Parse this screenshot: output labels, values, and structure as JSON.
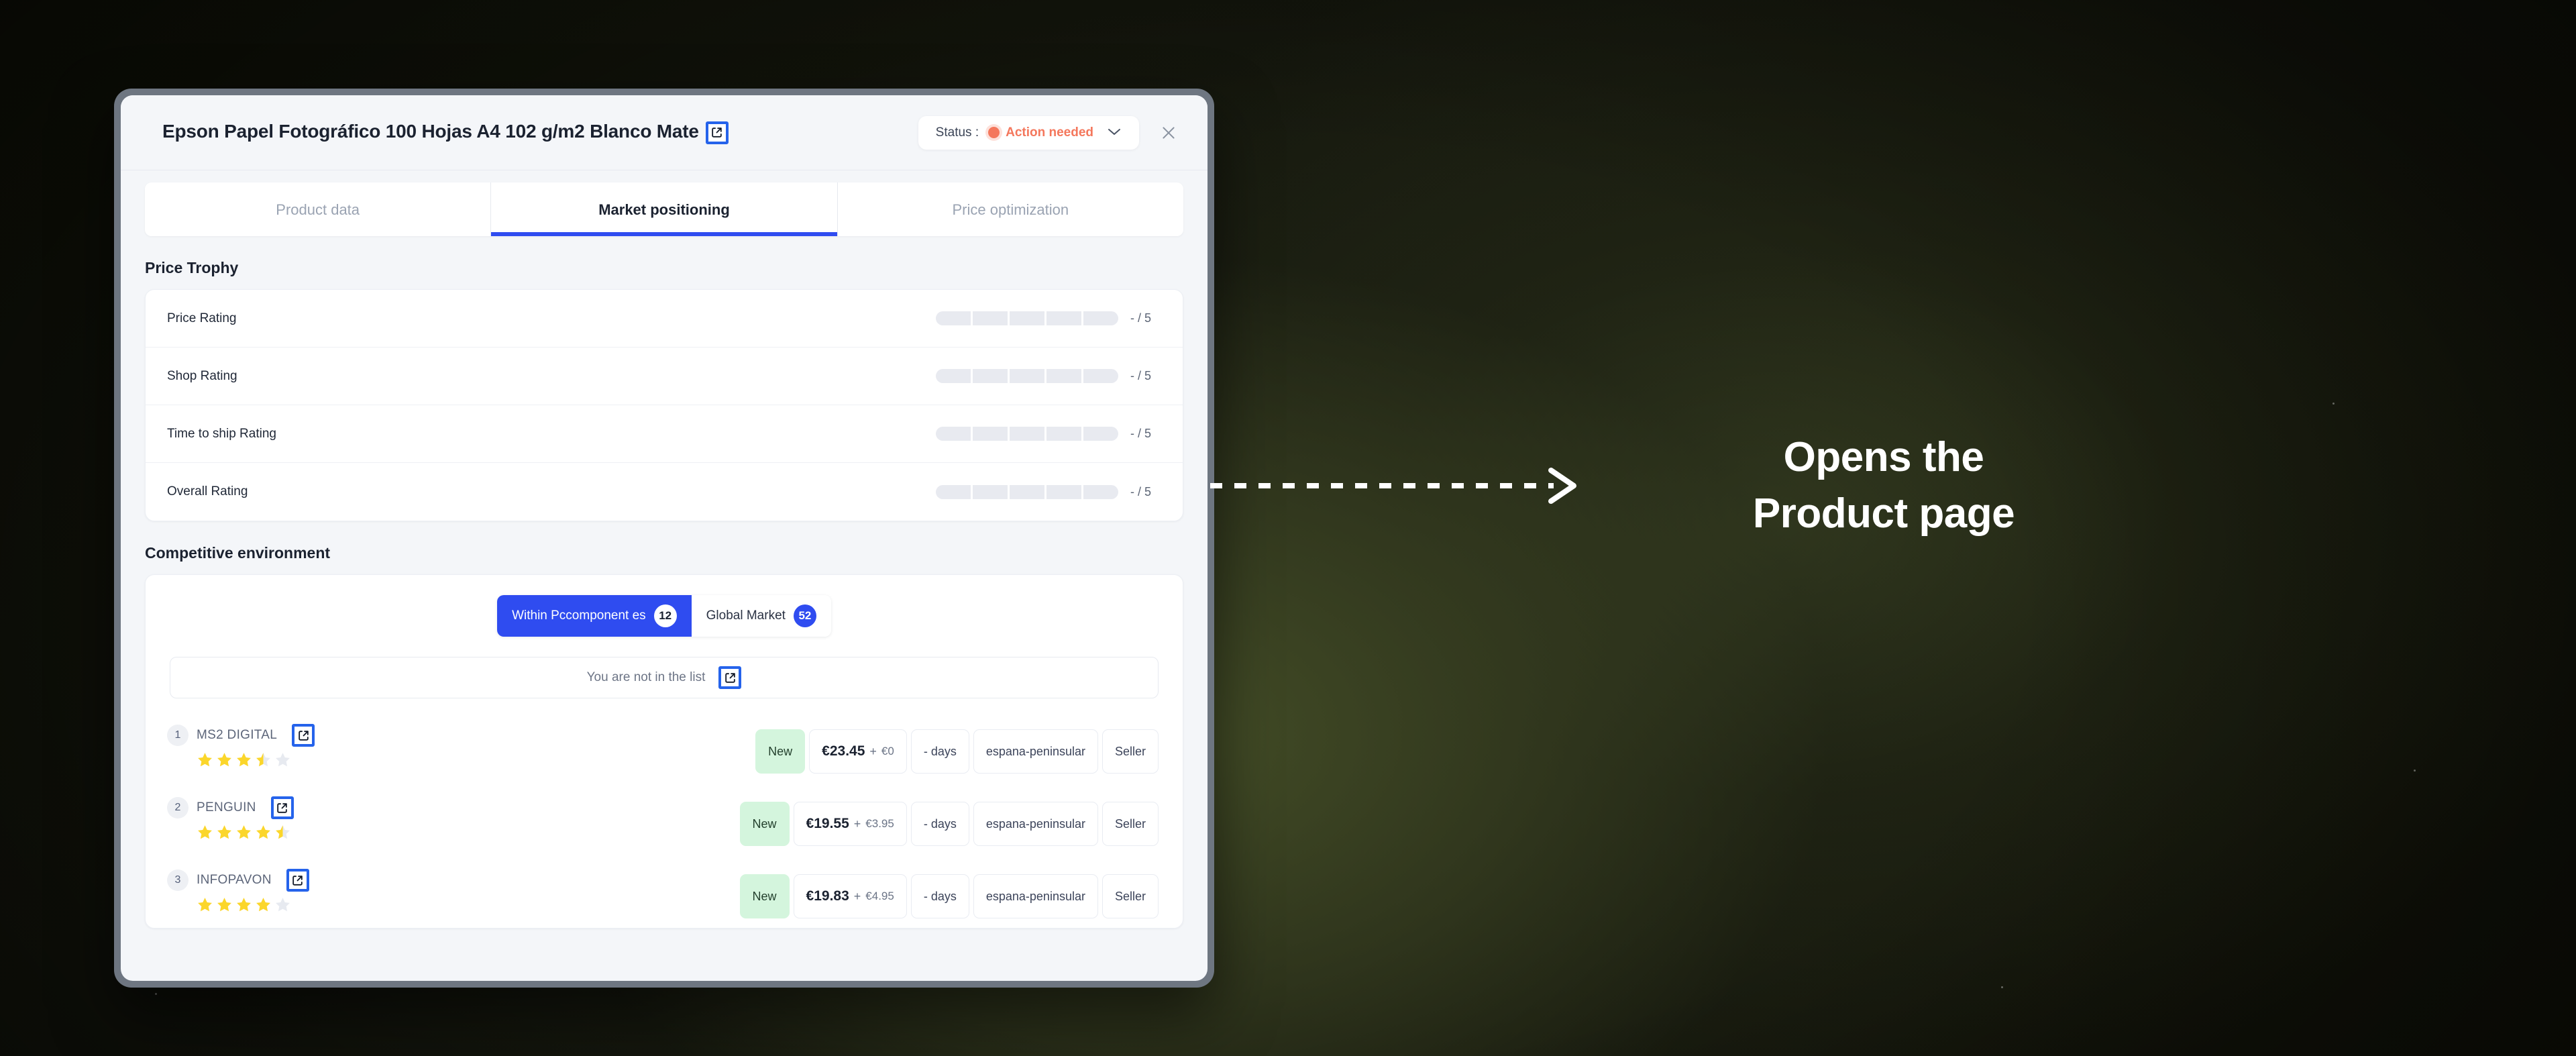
{
  "window": {
    "title": "Epson Papel Fotográfico 100 Hojas A4 102 g/m2 Blanco Mate",
    "title_link_icon": "external-link-icon",
    "close_icon": "close-icon"
  },
  "status": {
    "label": "Status :",
    "value": "Action needed",
    "dot_color": "#f4775c",
    "text_color": "#f4775c",
    "caret": "⌄"
  },
  "tabs": [
    {
      "label": "Product data",
      "active": false
    },
    {
      "label": "Market positioning",
      "active": true
    },
    {
      "label": "Price optimization",
      "active": false
    }
  ],
  "price_trophy": {
    "title": "Price Trophy",
    "segments": 5,
    "rows": [
      {
        "label": "Price Rating",
        "score": "- / 5",
        "filled": 0
      },
      {
        "label": "Shop Rating",
        "score": "- / 5",
        "filled": 0
      },
      {
        "label": "Time to ship Rating",
        "score": "- / 5",
        "filled": 0
      },
      {
        "label": "Overall Rating",
        "score": "- / 5",
        "filled": 0
      }
    ]
  },
  "competitive_environment": {
    "title": "Competitive environment",
    "segmented": [
      {
        "label": "Within Pccomponent es",
        "badge": "12",
        "active": true
      },
      {
        "label": "Global Market",
        "badge": "52",
        "active": false
      }
    ],
    "not_in_list": {
      "text": "You are not in the list",
      "icon": "external-link-icon"
    },
    "sellers": [
      {
        "rank": "1",
        "name": "MS2 DIGITAL",
        "link_icon": "external-link-icon",
        "rating": 3.5,
        "condition": "New",
        "price": "€23.45",
        "plus": "+",
        "shipping": "€0",
        "delivery": "- days",
        "region": "espana-peninsular",
        "type": "Seller"
      },
      {
        "rank": "2",
        "name": "PENGUIN",
        "link_icon": "external-link-icon",
        "rating": 4.5,
        "condition": "New",
        "price": "€19.55",
        "plus": "+",
        "shipping": "€3.95",
        "delivery": "- days",
        "region": "espana-peninsular",
        "type": "Seller"
      },
      {
        "rank": "3",
        "name": "INFOPAVON",
        "link_icon": "external-link-icon",
        "rating": 4,
        "condition": "New",
        "price": "€19.83",
        "plus": "+",
        "shipping": "€4.95",
        "delivery": "- days",
        "region": "espana-peninsular",
        "type": "Seller"
      }
    ]
  },
  "annotation": {
    "line1": "Opens the",
    "line2": "Product page",
    "arrow_icon": "dashed-arrow-right-icon"
  },
  "colors": {
    "accent_blue": "#2f4cf0",
    "star_yellow": "#fbd62b",
    "new_badge_bg": "#d4f5dd",
    "status_red": "#f4775c",
    "window_frame": "#6e7681",
    "background": "#14160f"
  }
}
